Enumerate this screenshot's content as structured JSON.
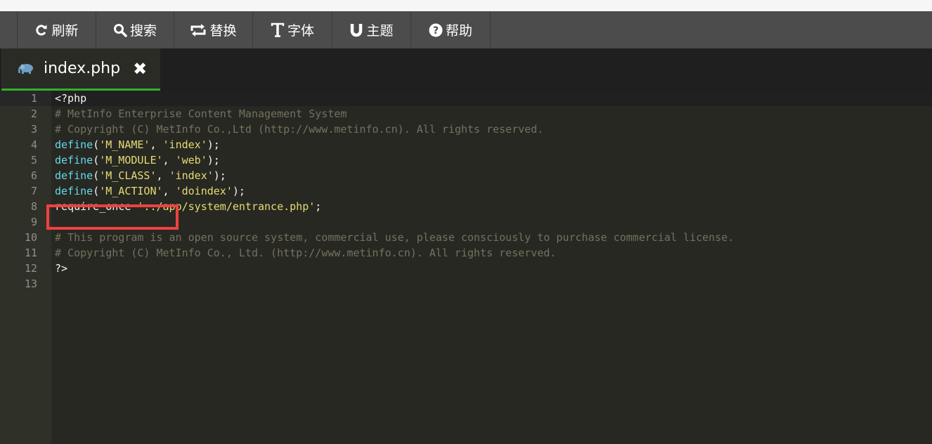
{
  "toolbar": {
    "buttons": [
      {
        "label": "刷新",
        "icon": "refresh-icon"
      },
      {
        "label": "搜索",
        "icon": "search-icon"
      },
      {
        "label": "替换",
        "icon": "replace-icon"
      },
      {
        "label": "字体",
        "icon": "text-icon"
      },
      {
        "label": "主题",
        "icon": "magnet-icon"
      },
      {
        "label": "帮助",
        "icon": "help-icon"
      }
    ]
  },
  "tab": {
    "filename": "index.php",
    "icon": "php-elephant-icon",
    "close_glyph": "✖",
    "active_color": "#2fb12f"
  },
  "editor": {
    "theme_colors": {
      "background": "#272822",
      "comment": "#75715e",
      "function": "#66d9ef",
      "string": "#e6db74",
      "text": "#f8f8f2"
    },
    "lines": [
      {
        "num": "1",
        "text": "<?php"
      },
      {
        "num": "2",
        "text": "# MetInfo Enterprise Content Management System"
      },
      {
        "num": "3",
        "text": "# Copyright (C) MetInfo Co.,Ltd (http://www.metinfo.cn). All rights reserved."
      },
      {
        "num": "4",
        "fn": "define",
        "open": "(",
        "arg1": "'M_NAME'",
        "sep": ", ",
        "arg2": "'index'",
        "close": ");"
      },
      {
        "num": "5",
        "fn": "define",
        "open": "(",
        "arg1": "'M_MODULE'",
        "sep": ", ",
        "arg2": "'web'",
        "close": ");"
      },
      {
        "num": "6",
        "fn": "define",
        "open": "(",
        "arg1": "'M_CLASS'",
        "sep": ", ",
        "arg2": "'index'",
        "close": ");"
      },
      {
        "num": "7",
        "fn": "define",
        "open": "(",
        "arg1": "'M_ACTION'",
        "sep": ", ",
        "arg2": "'doindex'",
        "close": ");"
      },
      {
        "num": "8",
        "fn": "require_once",
        "sep": " ",
        "arg1": "'../app/system/entrance.php'",
        "close": ";"
      },
      {
        "num": "9",
        "text": ""
      },
      {
        "num": "10",
        "text": "# This program is an open source system, commercial use, please consciously to purchase commercial license."
      },
      {
        "num": "11",
        "text": "# Copyright (C) MetInfo Co., Ltd. (http://www.metinfo.cn). All rights reserved."
      },
      {
        "num": "12",
        "text": "?>"
      },
      {
        "num": "13",
        "text": ""
      }
    ]
  },
  "annotation": {
    "color": "#f04141"
  }
}
